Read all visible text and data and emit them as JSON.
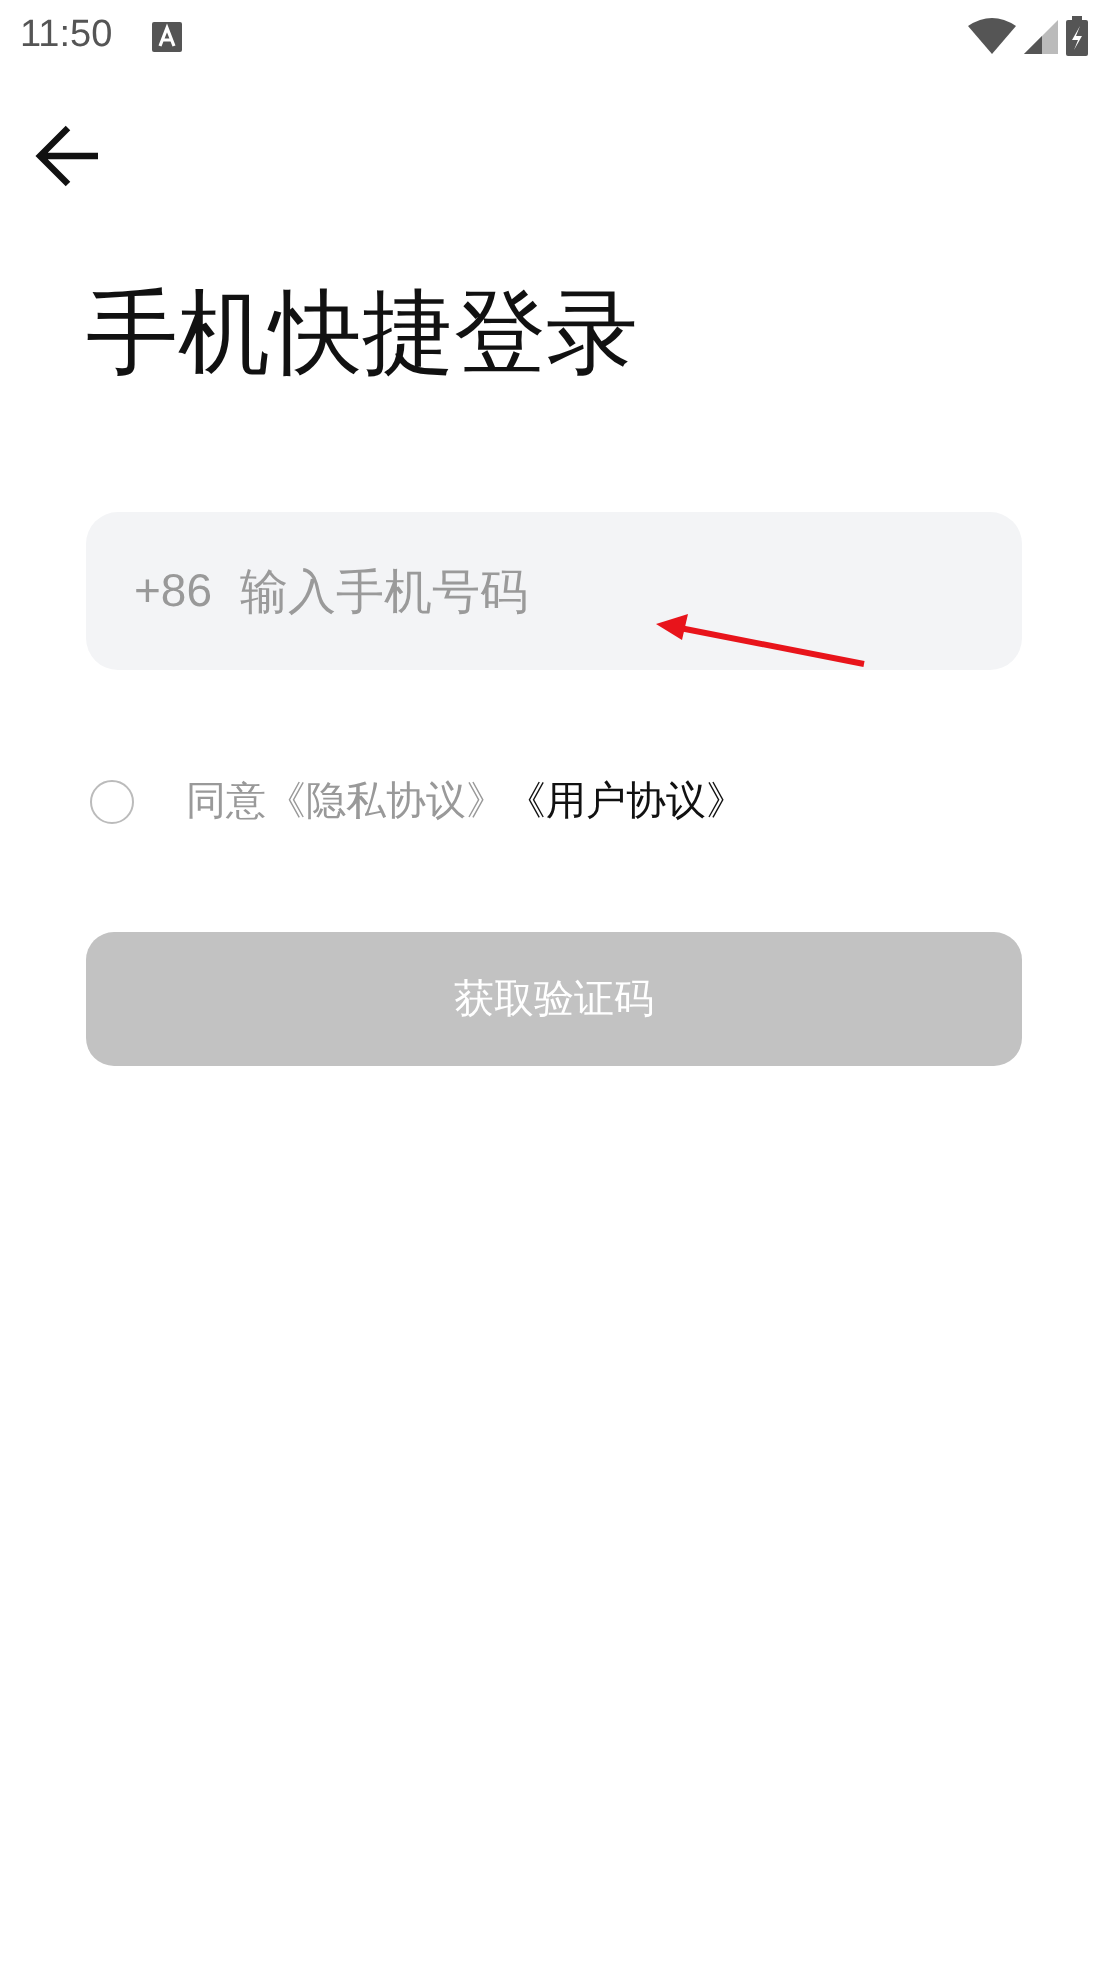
{
  "status_bar": {
    "time": "11:50"
  },
  "title": "手机快捷登录",
  "phone_field": {
    "prefix": "+86",
    "placeholder": "输入手机号码"
  },
  "agreement": {
    "checked": false,
    "label": "同意",
    "links": [
      {
        "text": "《隐私协议》",
        "highlighted": false
      },
      {
        "text": "《用户协议》",
        "highlighted": true
      }
    ]
  },
  "submit_button": {
    "label": "获取验证码",
    "disabled": true
  },
  "annotation": {
    "kind": "arrow",
    "color": "#e8141b"
  }
}
